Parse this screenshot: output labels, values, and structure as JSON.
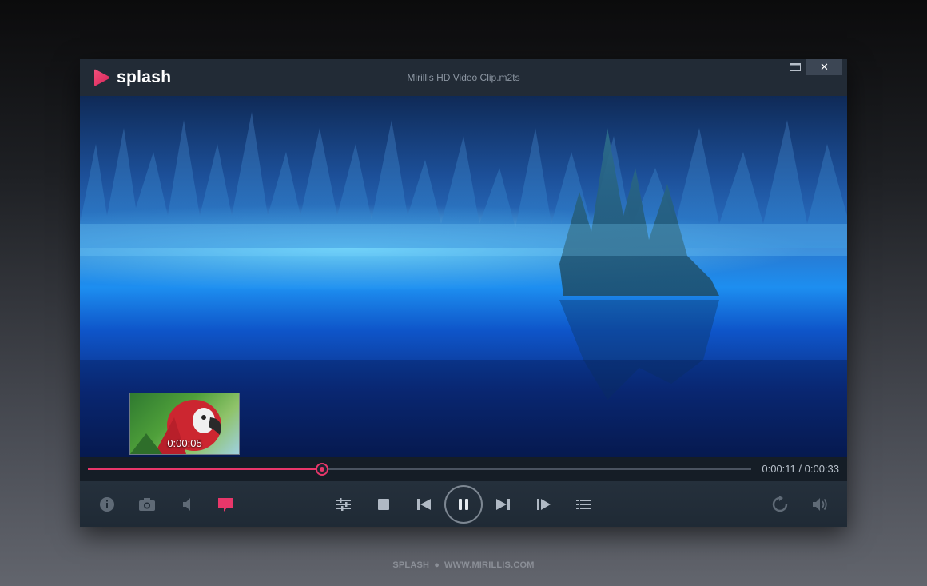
{
  "app": {
    "name": "splash",
    "window_title": "Mirillis HD Video Clip.m2ts",
    "close_label": "✕"
  },
  "player": {
    "thumbnail_time": "0:00:05",
    "time_display": "0:00:11 / 0:00:33",
    "progress_fraction": 0.353
  },
  "controls": {
    "left": [
      "info-icon",
      "camera-icon",
      "audio-icon",
      "subtitles-icon"
    ],
    "center": [
      "equalizer-icon",
      "stop-icon",
      "previous-icon",
      "pause-icon",
      "next-icon",
      "frame-step-icon",
      "playlist-icon"
    ],
    "right": [
      "repeat-icon",
      "volume-icon"
    ]
  },
  "colors": {
    "accent": "#e8376a",
    "icon": "#b0b9c4",
    "icon_muted": "#5f6a76"
  },
  "footer": {
    "brand": "SPLASH",
    "separator": "●",
    "url": "WWW.MIRILLIS.COM"
  }
}
